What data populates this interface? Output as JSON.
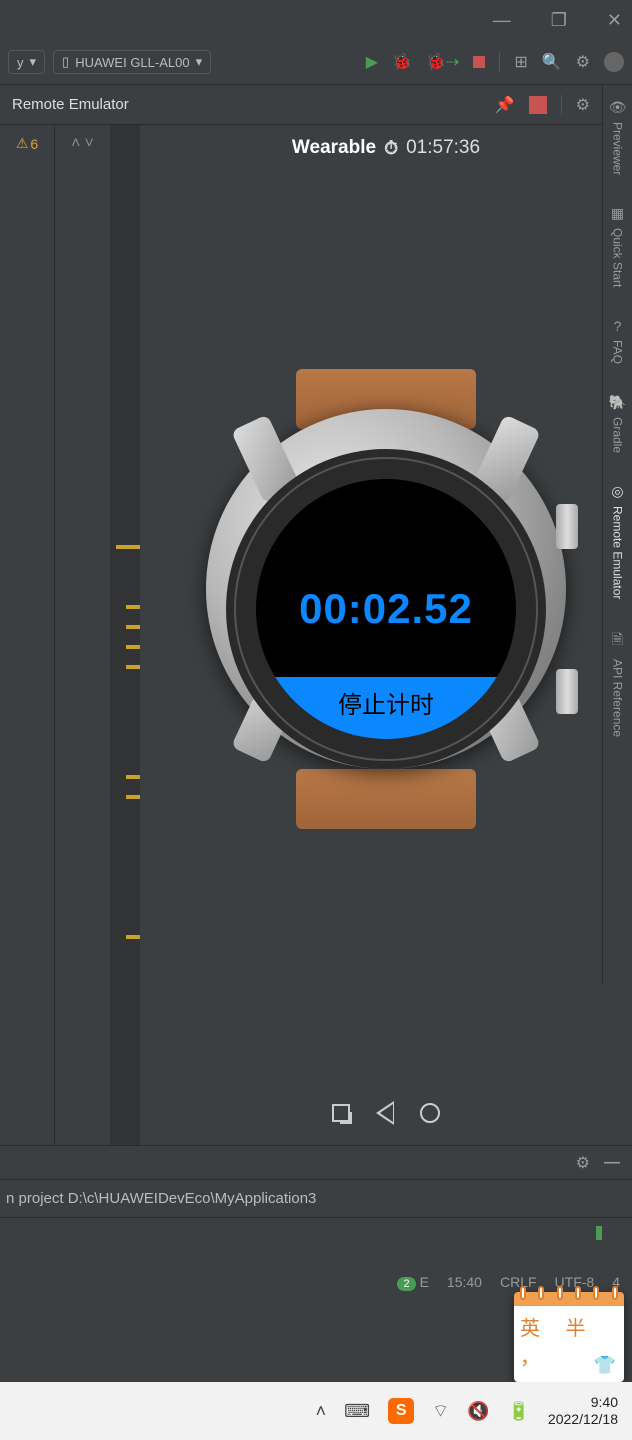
{
  "window": {
    "minimize": "—",
    "maximize": "❐",
    "close": "✕"
  },
  "toolbar": {
    "partial_dropdown": "y",
    "device_dropdown": "HUAWEI GLL-AL00"
  },
  "panel": {
    "title": "Remote Emulator"
  },
  "warnings": {
    "count": "6"
  },
  "emulator": {
    "device_label": "Wearable",
    "session_time": "01:57:36",
    "stopwatch_value": "00:02.52",
    "stop_button_label": "停止计时"
  },
  "sidebar": {
    "items": [
      "Previewer",
      "Quick Start",
      "FAQ",
      "Gradle",
      "Remote Emulator",
      "API Reference"
    ]
  },
  "log": {
    "text": "n project D:\\c\\HUAWEIDevEco\\MyApplication3"
  },
  "status": {
    "event_badge": "2",
    "event_letter": "E",
    "cursor": "15:40",
    "line_ending": "CRLF",
    "encoding": "UTF-8",
    "indent_partial": "4"
  },
  "sticky": {
    "chars": "英 半",
    "comma": "，"
  },
  "taskbar": {
    "time": "9:40",
    "date": "2022/12/18"
  }
}
